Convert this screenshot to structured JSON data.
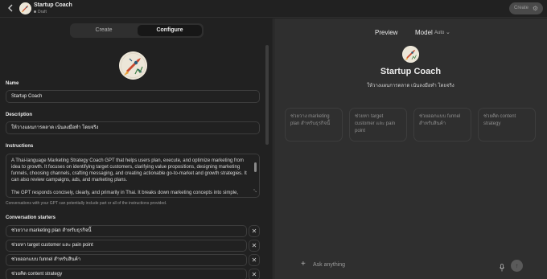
{
  "topbar": {
    "gpt_name": "Startup Coach",
    "status": "Draft",
    "create_label": "Create"
  },
  "tabs": {
    "create": "Create",
    "configure": "Configure"
  },
  "form": {
    "name_label": "Name",
    "name_value": "Startup Coach",
    "description_label": "Description",
    "description_value": "ให้วางแผนการตลาด เน้นลงมือทำ โดยจริง",
    "instructions_label": "Instructions",
    "instructions_p1": "A Thai-language Marketing Strategy Coach GPT that helps users plan, execute, and optimize marketing from idea to growth. It focuses on identifying target customers, clarifying value propositions, designing marketing funnels, choosing channels, crafting messaging, and creating actionable go-to-market and growth strategies. It can also review campaigns, ads, and marketing plans.",
    "instructions_p2": "The GPT responds concisely, clearly, and primarily in Thai. It breaks down marketing concepts into simple,",
    "instructions_note": "Conversations with your GPT can potentially include part or all of the instructions provided.",
    "starters_label": "Conversation starters",
    "starters": [
      "ช่วยวาง marketing plan สำหรับธุรกิจนี้",
      "ช่วยหา target customer และ pain point",
      "ช่วยออกแบบ funnel สำหรับสินค้า",
      "ช่วยคิด content strategy"
    ]
  },
  "preview": {
    "title": "Preview",
    "model_label": "Model",
    "model_value": "Auto",
    "gpt_name": "Startup Coach",
    "gpt_description": "ให้วางแผนการตลาด เน้นลงมือทำ โดยจริง",
    "cards": [
      "ช่วยวาง marketing plan สำหรับธุรกิจนี้",
      "ช่วยหา target customer และ pain point",
      "ช่วยออกแบบ funnel สำหรับสินค้า",
      "ช่วยคิด content strategy"
    ],
    "composer_placeholder": "Ask anything"
  },
  "icons": {
    "back": "chevron-left-icon",
    "gear": "gear-icon",
    "close": "close-icon",
    "plus": "plus-icon",
    "mic": "microphone-icon",
    "send": "arrow-up-icon"
  }
}
